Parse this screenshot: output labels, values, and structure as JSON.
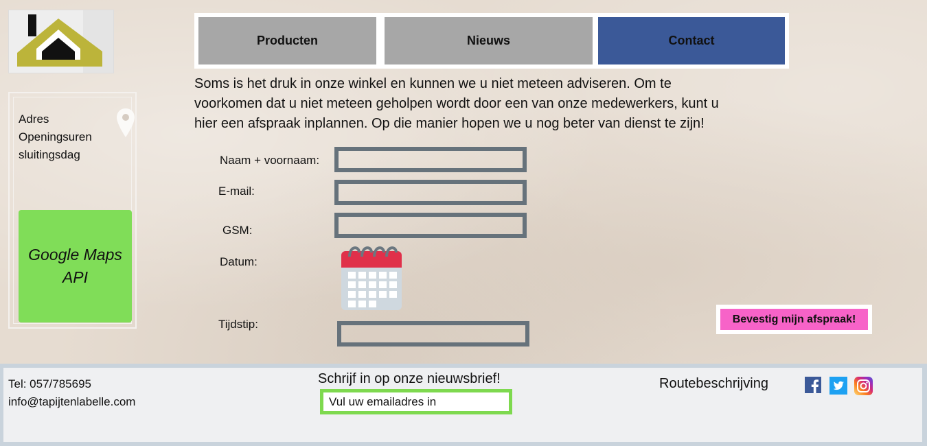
{
  "nav": {
    "tabs": [
      {
        "label": "Producten"
      },
      {
        "label": "Nieuws"
      },
      {
        "label": "Contact"
      }
    ]
  },
  "sidebar": {
    "adres": "Adres",
    "openingsuren": "Openingsuren",
    "sluitingsdag": "sluitingsdag",
    "maps_line1": "Google Maps",
    "maps_line2": "API"
  },
  "intro": {
    "line1": "Soms is het druk in onze winkel en kunnen we u niet meteen adviseren. Om te",
    "line2": "voorkomen dat u niet meteen geholpen wordt door een van onze medewerkers, kunt u",
    "line3": "hier een afspraak inplannen. Op die manier hopen we u nog beter van dienst te zijn!"
  },
  "form": {
    "name_label": "Naam + voornaam:",
    "email_label": "E-mail:",
    "gsm_label": "GSM:",
    "date_label": "Datum:",
    "time_label": "Tijdstip:",
    "submit_label": "Bevestig mijn afspraak!"
  },
  "footer": {
    "phone": "Tel: 057/785695",
    "email": "info@tapijtenlabelle.com",
    "newsletter_title": "Schrijf in op onze nieuwsbrief!",
    "newsletter_placeholder": "Vul uw emailadres in",
    "route": "Routebeschrijving"
  },
  "colors": {
    "nav_active": "#3b5998",
    "nav_inactive": "#a7a7a7",
    "maps_green": "#80dd58",
    "confirm_pink": "#f763c8",
    "field_border": "#66727b"
  },
  "icons": [
    "logo-house-icon",
    "location-pin-icon",
    "calendar-icon",
    "facebook-icon",
    "twitter-icon",
    "instagram-icon"
  ]
}
